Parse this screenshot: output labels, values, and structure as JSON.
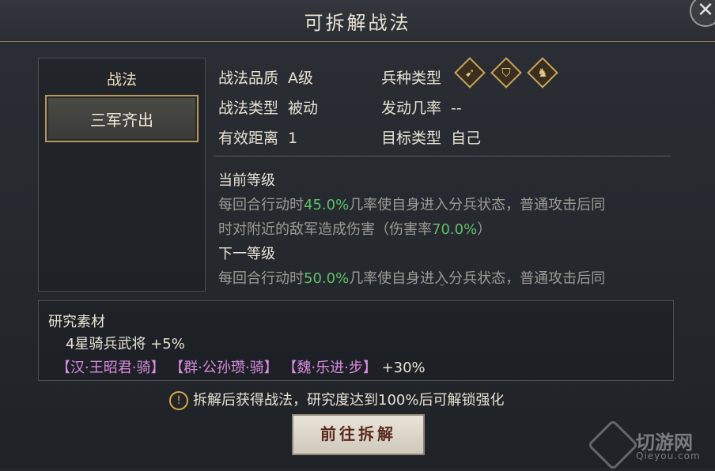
{
  "title": "可拆解战法",
  "close_label": "✕",
  "left_panel": {
    "title": "战法",
    "skill_name": "三军齐出"
  },
  "attributes": {
    "quality_label": "战法品质",
    "quality_value": "A级",
    "unit_type_label": "兵种类型",
    "tactic_type_label": "战法类型",
    "tactic_type_value": "被动",
    "trigger_rate_label": "发动几率",
    "trigger_rate_value": "--",
    "range_label": "有效距离",
    "range_value": "1",
    "target_label": "目标类型",
    "target_value": "自己",
    "unit_icons": [
      "bow-icon",
      "shield-icon",
      "horse-icon"
    ]
  },
  "description": {
    "current_header": "当前等级",
    "current_line1_a": "每回合行动时",
    "current_line1_rate": "45.0%",
    "current_line1_b": "几率使自身进入分兵状态，普通攻击后同",
    "current_line2_a": "时对附近的敌军造成伤害（伤害率",
    "current_line2_rate": "70.0%",
    "current_line2_b": "）",
    "next_header": "下一等级",
    "next_line1_a": "每回合行动时",
    "next_line1_rate": "50.0%",
    "next_line1_b": "几率使自身进入分兵状态，普通攻击后同"
  },
  "research": {
    "title": "研究素材",
    "line1": "4星骑兵武将 +5%",
    "generals": [
      "【汉·王昭君·骑】",
      "【群·公孙瓒·骑】",
      "【魏·乐进·步】"
    ],
    "bonus": "+30%"
  },
  "notice": {
    "icon": "!",
    "text": "拆解后获得战法，研究度达到100%后可解锁强化"
  },
  "button_label": "前往拆解",
  "watermark": {
    "text": "切游网",
    "sub": "Qieyou.com"
  },
  "colors": {
    "highlight_green": "#5fbf6a",
    "general_pink": "#d98be0",
    "gold": "#c9a55c"
  }
}
